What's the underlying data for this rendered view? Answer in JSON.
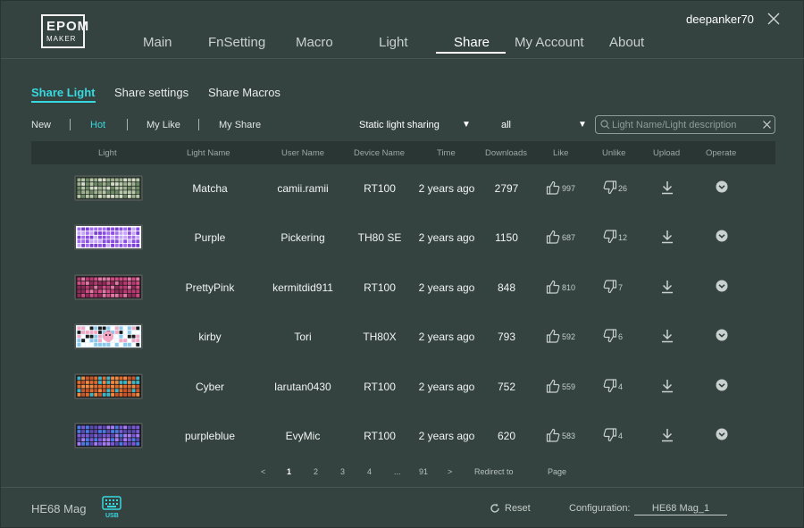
{
  "logo": {
    "line1": "EPOM",
    "line2": "MAKER"
  },
  "header": {
    "username": "deepanker70"
  },
  "nav": [
    {
      "label": "Main"
    },
    {
      "label": "FnSetting"
    },
    {
      "label": "Macro"
    },
    {
      "label": "Light"
    },
    {
      "label": "Share"
    },
    {
      "label": "My Account"
    },
    {
      "label": "About"
    }
  ],
  "active_nav": "Share",
  "subtabs": [
    {
      "label": "Share Light"
    },
    {
      "label": "Share settings"
    },
    {
      "label": "Share Macros"
    }
  ],
  "filters": [
    {
      "label": "New"
    },
    {
      "label": "Hot"
    },
    {
      "label": "My Like"
    },
    {
      "label": "My Share"
    }
  ],
  "active_filter": "Hot",
  "dropdowns": {
    "type": "Static light sharing",
    "device": "all"
  },
  "search": {
    "placeholder": "Light Name/Light description",
    "value": ""
  },
  "table": {
    "columns": [
      "Light",
      "Light Name",
      "User Name",
      "Device Name",
      "Time",
      "Downloads",
      "Like",
      "Unlike",
      "Upload",
      "Operate"
    ],
    "rows": [
      {
        "name": "Matcha",
        "user": "camii.ramii",
        "device": "RT100",
        "time": "2 years ago",
        "downloads": "2797",
        "likes": "997",
        "unlikes": "26",
        "theme": "matcha-icon"
      },
      {
        "name": "Purple",
        "user": "Pickering",
        "device": "TH80 SE",
        "time": "2 years ago",
        "downloads": "1150",
        "likes": "687",
        "unlikes": "12",
        "theme": "purple-icon"
      },
      {
        "name": "PrettyPink",
        "user": "kermitdid911",
        "device": "RT100",
        "time": "2 years ago",
        "downloads": "848",
        "likes": "810",
        "unlikes": "7",
        "theme": "pink-icon"
      },
      {
        "name": "kirby",
        "user": "Tori",
        "device": "TH80X",
        "time": "2 years ago",
        "downloads": "793",
        "likes": "592",
        "unlikes": "6",
        "theme": "kirby-icon"
      },
      {
        "name": "Cyber",
        "user": "larutan0430",
        "device": "RT100",
        "time": "2 years ago",
        "downloads": "752",
        "likes": "559",
        "unlikes": "4",
        "theme": "cyber-icon"
      },
      {
        "name": "purpleblue",
        "user": "EvyMic",
        "device": "RT100",
        "time": "2 years ago",
        "downloads": "620",
        "likes": "583",
        "unlikes": "4",
        "theme": "purpleblue-icon"
      }
    ]
  },
  "pagination": {
    "prev": "<",
    "pages": [
      "1",
      "2",
      "3",
      "4",
      "...",
      "91"
    ],
    "current": "1",
    "next": ">",
    "redirect_label": "Redirect to",
    "page_label": "Page"
  },
  "footer": {
    "device": "HE68 Mag",
    "usb_label": "USB",
    "reset_label": "Reset",
    "config_label": "Configuration:",
    "config_value": "HE68 Mag_1"
  },
  "colors": {
    "background": "#34433f",
    "accent": "#38d8e0",
    "table_header": "#2a3633"
  }
}
